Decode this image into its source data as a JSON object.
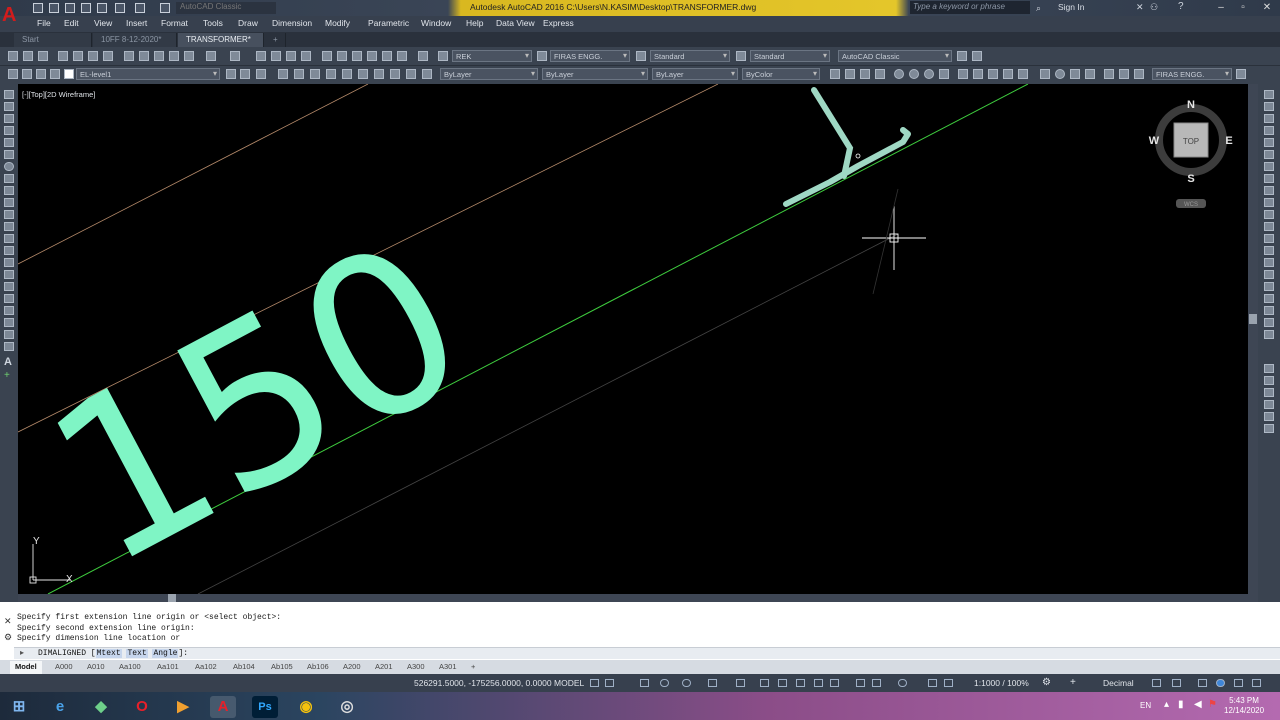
{
  "titlebar": {
    "title": "Autodesk AutoCAD 2016    C:\\Users\\N.KASIM\\Desktop\\TRANSFORMER.dwg",
    "workspace_name": "AutoCAD Classic",
    "search_placeholder": "Type a keyword or phrase",
    "signin": "Sign In"
  },
  "menubar": {
    "items": [
      "File",
      "Edit",
      "View",
      "Insert",
      "Format",
      "Tools",
      "Draw",
      "Dimension",
      "Modify",
      "Parametric",
      "Window",
      "Help",
      "Data View",
      "Express"
    ]
  },
  "tabs": [
    "Start",
    "10FF 8-12-2020*",
    "TRANSFORMER*",
    "+"
  ],
  "toolbar": {
    "layer_combo": "EL-level1",
    "text_style": "REK",
    "dim_style": "FIRAS ENGG.",
    "table_style": "Standard",
    "mleader_style": "Standard",
    "workspace": "AutoCAD Classic",
    "color": "ByLayer",
    "linetype": "ByLayer",
    "lineweight": "ByLayer",
    "plotstyle": "ByColor",
    "dim_style_right": "FIRAS ENGG."
  },
  "viewport": {
    "label": "[-][Top][2D Wireframe]",
    "dimension_text": "150",
    "navcube": {
      "n": "N",
      "s": "S",
      "e": "E",
      "w": "W",
      "face": "TOP",
      "wcs": "WCS"
    },
    "ucs": {
      "x": "X",
      "y": "Y"
    }
  },
  "command": {
    "history": [
      "Specify first extension line origin or <select object>:",
      "Specify second extension line origin:",
      "Specify dimension line location or"
    ],
    "prompt_prefix": "DIMALIGNED [",
    "options": [
      "Mtext",
      "Text",
      "Angle"
    ],
    "prompt_suffix": "]:"
  },
  "layout_tabs": [
    "Model",
    "A000",
    "A010",
    "Aa100",
    "Aa101",
    "Aa102",
    "Ab104",
    "Ab105",
    "Ab106",
    "A200",
    "A201",
    "A300",
    "A301",
    "+"
  ],
  "status": {
    "coords": "526291.5000, -175256.0000, 0.0000",
    "model": "MODEL",
    "scale": "1:1000 / 100%",
    "units": "Decimal"
  },
  "taskbar": {
    "lang": "EN",
    "time": "5:43 PM",
    "date": "12/14/2020",
    "apps": [
      "start",
      "ie",
      "autocad-exchange",
      "opera",
      "media",
      "autocad",
      "photoshop",
      "chrome",
      "obs"
    ]
  },
  "colors": {
    "dim_text": "#7ff5c5",
    "dim_line": "#4ad44a",
    "ext_line": "#b58a6a",
    "autocad_red": "#d21c1c"
  }
}
